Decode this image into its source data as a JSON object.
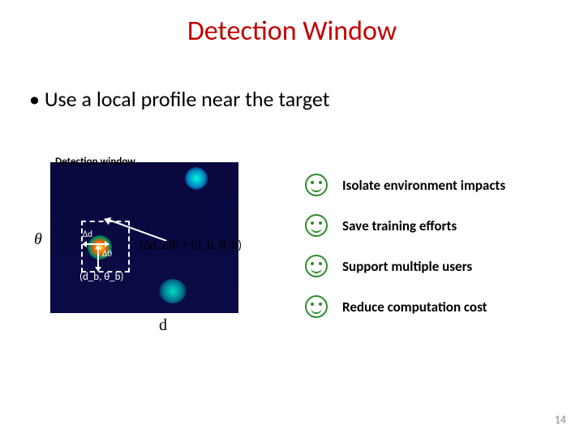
{
  "title": "Detection Window",
  "bullet": "Use a local profile near the target",
  "figure": {
    "window_label": "Detection window",
    "delta_d_label": "Δd",
    "delta_theta_label": "Δθ",
    "base_point_label": "(d_b, θ_b)",
    "delta_combo_label": "(Δd, Δθ) + (d_b, θ_b)",
    "axis_y": "θ",
    "axis_x": "d"
  },
  "benefits": [
    "Isolate environment impacts",
    "Save training efforts",
    "Support multiple users",
    "Reduce computation cost"
  ],
  "page_number": "14"
}
